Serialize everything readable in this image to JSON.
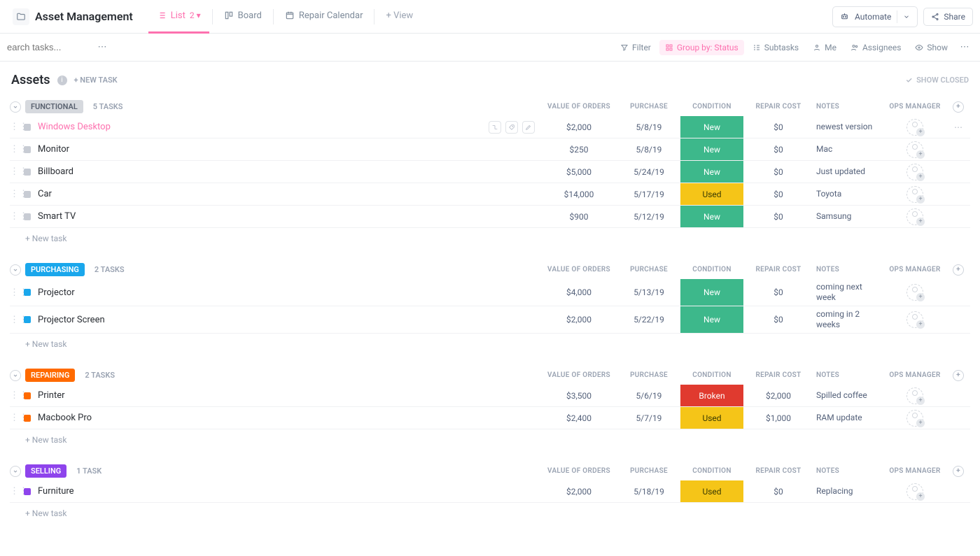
{
  "header": {
    "title": "Asset Management",
    "views": [
      {
        "id": "list",
        "label": "List",
        "badge": "2",
        "active": true
      },
      {
        "id": "board",
        "label": "Board",
        "badge": "",
        "active": false
      },
      {
        "id": "repair-calendar",
        "label": "Repair Calendar",
        "badge": "",
        "active": false
      }
    ],
    "addViewLabel": "+  View",
    "automate": "Automate",
    "share": "Share"
  },
  "toolbar": {
    "searchPlaceholder": "earch tasks...",
    "filter": "Filter",
    "groupBy": "Group by: Status",
    "subtasks": "Subtasks",
    "me": "Me",
    "assignees": "Assignees",
    "show": "Show"
  },
  "assets": {
    "title": "Assets",
    "newTask": "+ NEW TASK",
    "showClosed": "SHOW CLOSED"
  },
  "columns": {
    "valueOfOrders": "VALUE OF ORDERS",
    "purchase": "PURCHASE",
    "condition": "CONDITION",
    "repairCost": "REPAIR COST",
    "notes": "NOTES",
    "opsManager": "OPS MANAGER"
  },
  "newTaskRow": "+ New task",
  "conditionColors": {
    "New": "#3db88b",
    "Used": "#f5c518",
    "Broken": "#e03a2f",
    "UsedText": "#3a3a00"
  },
  "groups": [
    {
      "id": "functional",
      "label": "FUNCTIONAL",
      "pillBg": "#d6d9de",
      "pillColor": "#5a6270",
      "sqColor": "#c8ccd4",
      "countLabel": "5 TASKS",
      "tasks": [
        {
          "name": "Windows Desktop",
          "active": true,
          "value": "$2,000",
          "purchase": "5/8/19",
          "condition": "New",
          "repair": "$0",
          "notes": "newest version",
          "showMore": true
        },
        {
          "name": "Monitor",
          "active": false,
          "value": "$250",
          "purchase": "5/8/19",
          "condition": "New",
          "repair": "$0",
          "notes": "Mac"
        },
        {
          "name": "Billboard",
          "active": false,
          "value": "$5,000",
          "purchase": "5/24/19",
          "condition": "New",
          "repair": "$0",
          "notes": "Just updated"
        },
        {
          "name": "Car",
          "active": false,
          "value": "$14,000",
          "purchase": "5/17/19",
          "condition": "Used",
          "repair": "$0",
          "notes": "Toyota"
        },
        {
          "name": "Smart TV",
          "active": false,
          "value": "$900",
          "purchase": "5/12/19",
          "condition": "New",
          "repair": "$0",
          "notes": "Samsung"
        }
      ]
    },
    {
      "id": "purchasing",
      "label": "PURCHASING",
      "pillBg": "#1aa7ec",
      "pillColor": "#ffffff",
      "sqColor": "#1aa7ec",
      "countLabel": "2 TASKS",
      "tasks": [
        {
          "name": "Projector",
          "active": false,
          "value": "$4,000",
          "purchase": "5/13/19",
          "condition": "New",
          "repair": "$0",
          "notes": "coming next week"
        },
        {
          "name": "Projector Screen",
          "active": false,
          "value": "$2,000",
          "purchase": "5/22/19",
          "condition": "New",
          "repair": "$0",
          "notes": "coming in 2 weeks"
        }
      ]
    },
    {
      "id": "repairing",
      "label": "REPAIRING",
      "pillBg": "#ff6a00",
      "pillColor": "#ffffff",
      "sqColor": "#ff6a00",
      "countLabel": "2 TASKS",
      "tasks": [
        {
          "name": "Printer",
          "active": false,
          "value": "$3,500",
          "purchase": "5/6/19",
          "condition": "Broken",
          "repair": "$2,000",
          "notes": "Spilled coffee"
        },
        {
          "name": "Macbook Pro",
          "active": false,
          "value": "$2,400",
          "purchase": "5/7/19",
          "condition": "Used",
          "repair": "$1,000",
          "notes": "RAM update"
        }
      ]
    },
    {
      "id": "selling",
      "label": "SELLING",
      "pillBg": "#8e44ec",
      "pillColor": "#ffffff",
      "sqColor": "#8e44ec",
      "countLabel": "1 TASK",
      "tasks": [
        {
          "name": "Furniture",
          "active": false,
          "value": "$2,000",
          "purchase": "5/18/19",
          "condition": "Used",
          "repair": "$0",
          "notes": "Replacing"
        }
      ]
    }
  ]
}
